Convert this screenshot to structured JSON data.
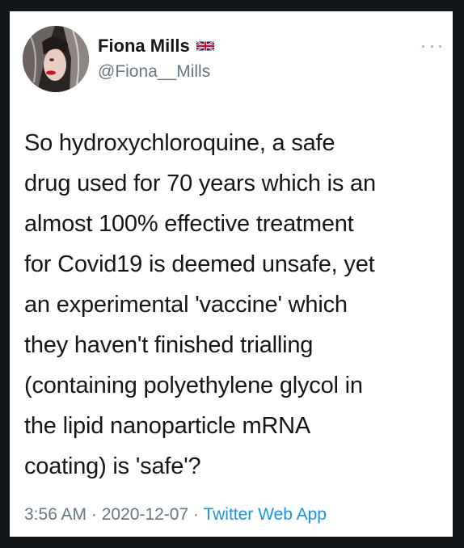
{
  "user": {
    "display_name": "Fiona Mills",
    "flag": "uk-flag-icon",
    "handle": "@Fiona__Mills"
  },
  "tweet": {
    "lines": [
      "So hydroxychloroquine, a safe",
      "drug used for 70 years which is an",
      "almost 100% effective treatment",
      "for Covid19 is deemed unsafe, yet",
      "an experimental 'vaccine' which",
      "they haven't finished trialling",
      "(containing polyethylene glycol in",
      "the lipid nanoparticle mRNA",
      "coating) is 'safe'?"
    ]
  },
  "meta": {
    "time": "3:56 AM",
    "separator": " · ",
    "date": "2020-12-07",
    "source": "Twitter Web App"
  },
  "colors": {
    "background": "#14171a",
    "card": "#ffffff",
    "text": "#14171a",
    "muted": "#657786",
    "link": "#1b95e0"
  }
}
